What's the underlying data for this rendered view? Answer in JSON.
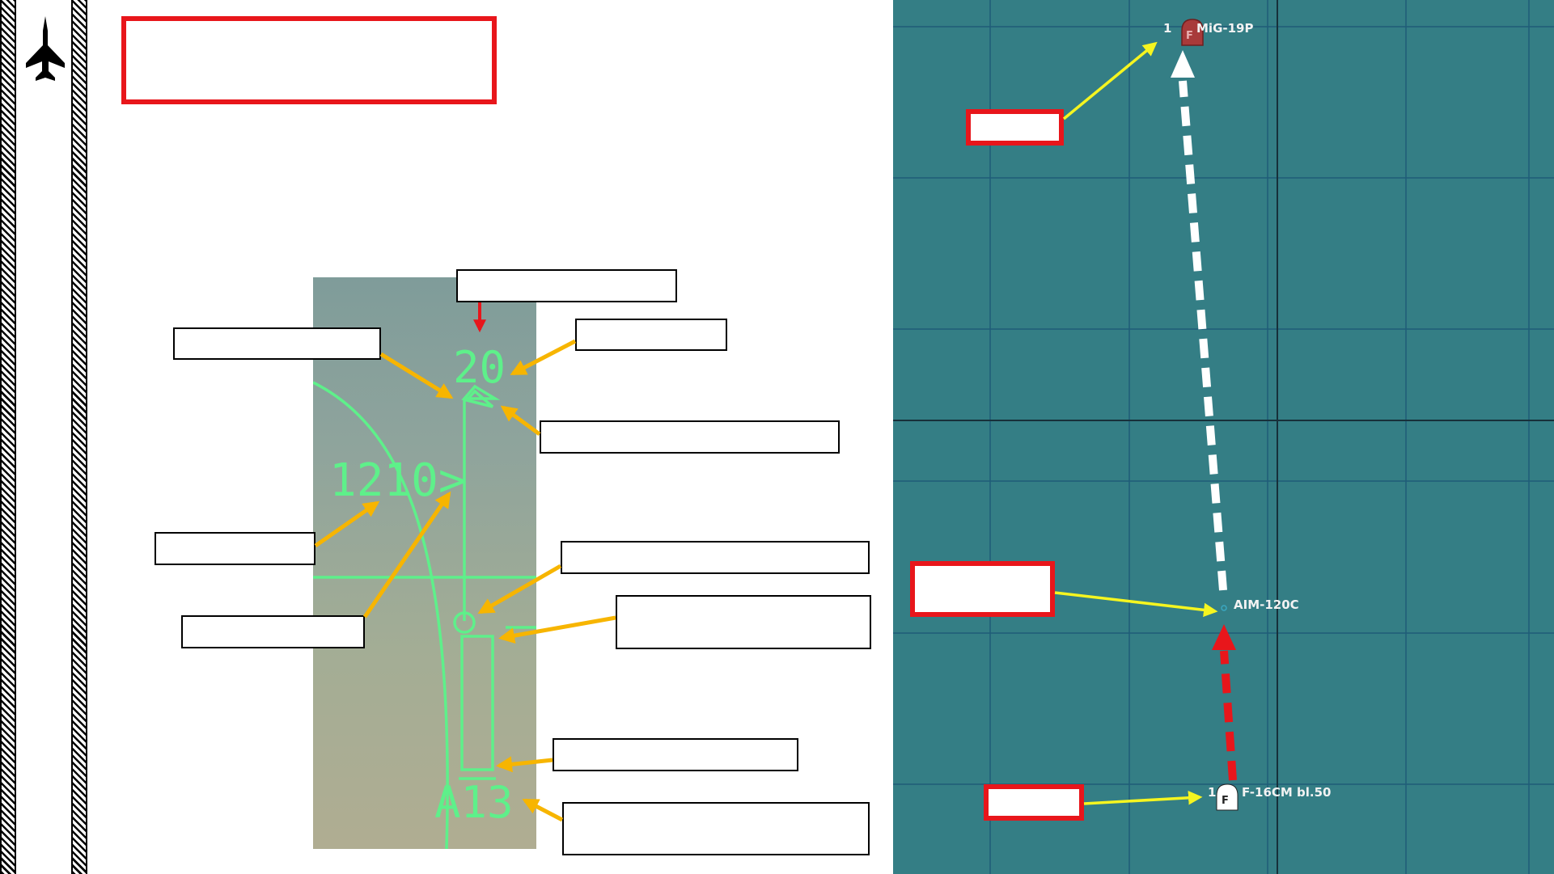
{
  "sidebar": {
    "icon": "fighter-jet-icon"
  },
  "hud": {
    "heading_value": "20",
    "target_range": "1210>",
    "altitude_label": "A13"
  },
  "map": {
    "target": {
      "count": "1",
      "badge": "F",
      "name": "MiG-19P"
    },
    "missile": {
      "name": "AIM-120C"
    },
    "ownship": {
      "count": "1",
      "badge": "F",
      "name": "F-16CM bl.50"
    }
  },
  "colors": {
    "callout_arrow": "#f7b500",
    "red_box": "#e8161b",
    "hud_symbology": "#5ef08a",
    "map_background": "#347e85",
    "map_pointer": "#f5f520"
  }
}
